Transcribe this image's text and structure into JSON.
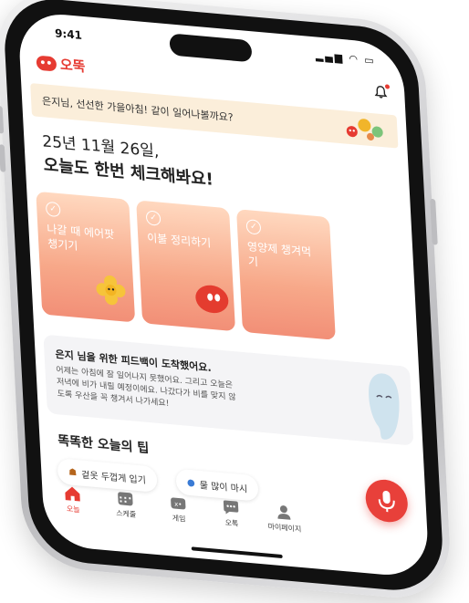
{
  "status": {
    "time": "9:41"
  },
  "app": {
    "name": "오뚝"
  },
  "banner": {
    "text": "은지님, 선선한 가을아침! 같이 일어나볼까요?"
  },
  "date": {
    "line1": "25년 11월 26일,",
    "line2": "오늘도 한번 체크해봐요!"
  },
  "cards": [
    {
      "label": "나갈 때 에어팟 챙기기"
    },
    {
      "label": "이불 정리하기"
    },
    {
      "label": "영양제 챙겨먹기"
    }
  ],
  "feedback": {
    "title": "은지 님을 위한 피드백이 도착했어요.",
    "body": "어제는 아침에 잘 일어나지 못했어요. 그리고 오늘은 저녁에 비가 내릴 예정이에요. 나갔다가 비를 맞지 않도록 우산을 꼭 챙겨서 나가세요!"
  },
  "tips": {
    "title": "똑똑한 오늘의 팁",
    "items": [
      {
        "label": "겉옷 두껍게 입기"
      },
      {
        "label": "물 많이 마시"
      }
    ]
  },
  "tabs": [
    {
      "label": "오늘"
    },
    {
      "label": "스케줄"
    },
    {
      "label": "게임"
    },
    {
      "label": "오톡"
    },
    {
      "label": "마이페이지"
    }
  ],
  "colors": {
    "brand": "#e63b32",
    "card": "#f7a889",
    "banner": "#fbeeda"
  }
}
